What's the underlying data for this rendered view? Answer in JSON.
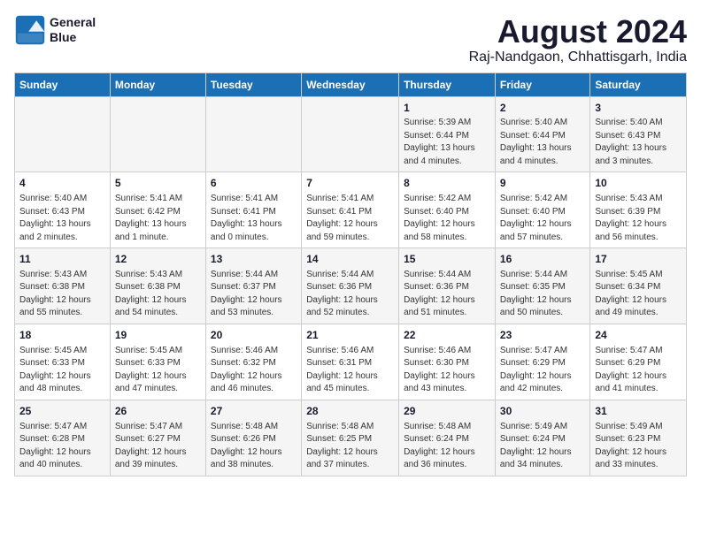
{
  "header": {
    "logo_line1": "General",
    "logo_line2": "Blue",
    "month_year": "August 2024",
    "location": "Raj-Nandgaon, Chhattisgarh, India"
  },
  "weekdays": [
    "Sunday",
    "Monday",
    "Tuesday",
    "Wednesday",
    "Thursday",
    "Friday",
    "Saturday"
  ],
  "weeks": [
    [
      {
        "day": "",
        "info": ""
      },
      {
        "day": "",
        "info": ""
      },
      {
        "day": "",
        "info": ""
      },
      {
        "day": "",
        "info": ""
      },
      {
        "day": "1",
        "info": "Sunrise: 5:39 AM\nSunset: 6:44 PM\nDaylight: 13 hours\nand 4 minutes."
      },
      {
        "day": "2",
        "info": "Sunrise: 5:40 AM\nSunset: 6:44 PM\nDaylight: 13 hours\nand 4 minutes."
      },
      {
        "day": "3",
        "info": "Sunrise: 5:40 AM\nSunset: 6:43 PM\nDaylight: 13 hours\nand 3 minutes."
      }
    ],
    [
      {
        "day": "4",
        "info": "Sunrise: 5:40 AM\nSunset: 6:43 PM\nDaylight: 13 hours\nand 2 minutes."
      },
      {
        "day": "5",
        "info": "Sunrise: 5:41 AM\nSunset: 6:42 PM\nDaylight: 13 hours\nand 1 minute."
      },
      {
        "day": "6",
        "info": "Sunrise: 5:41 AM\nSunset: 6:41 PM\nDaylight: 13 hours\nand 0 minutes."
      },
      {
        "day": "7",
        "info": "Sunrise: 5:41 AM\nSunset: 6:41 PM\nDaylight: 12 hours\nand 59 minutes."
      },
      {
        "day": "8",
        "info": "Sunrise: 5:42 AM\nSunset: 6:40 PM\nDaylight: 12 hours\nand 58 minutes."
      },
      {
        "day": "9",
        "info": "Sunrise: 5:42 AM\nSunset: 6:40 PM\nDaylight: 12 hours\nand 57 minutes."
      },
      {
        "day": "10",
        "info": "Sunrise: 5:43 AM\nSunset: 6:39 PM\nDaylight: 12 hours\nand 56 minutes."
      }
    ],
    [
      {
        "day": "11",
        "info": "Sunrise: 5:43 AM\nSunset: 6:38 PM\nDaylight: 12 hours\nand 55 minutes."
      },
      {
        "day": "12",
        "info": "Sunrise: 5:43 AM\nSunset: 6:38 PM\nDaylight: 12 hours\nand 54 minutes."
      },
      {
        "day": "13",
        "info": "Sunrise: 5:44 AM\nSunset: 6:37 PM\nDaylight: 12 hours\nand 53 minutes."
      },
      {
        "day": "14",
        "info": "Sunrise: 5:44 AM\nSunset: 6:36 PM\nDaylight: 12 hours\nand 52 minutes."
      },
      {
        "day": "15",
        "info": "Sunrise: 5:44 AM\nSunset: 6:36 PM\nDaylight: 12 hours\nand 51 minutes."
      },
      {
        "day": "16",
        "info": "Sunrise: 5:44 AM\nSunset: 6:35 PM\nDaylight: 12 hours\nand 50 minutes."
      },
      {
        "day": "17",
        "info": "Sunrise: 5:45 AM\nSunset: 6:34 PM\nDaylight: 12 hours\nand 49 minutes."
      }
    ],
    [
      {
        "day": "18",
        "info": "Sunrise: 5:45 AM\nSunset: 6:33 PM\nDaylight: 12 hours\nand 48 minutes."
      },
      {
        "day": "19",
        "info": "Sunrise: 5:45 AM\nSunset: 6:33 PM\nDaylight: 12 hours\nand 47 minutes."
      },
      {
        "day": "20",
        "info": "Sunrise: 5:46 AM\nSunset: 6:32 PM\nDaylight: 12 hours\nand 46 minutes."
      },
      {
        "day": "21",
        "info": "Sunrise: 5:46 AM\nSunset: 6:31 PM\nDaylight: 12 hours\nand 45 minutes."
      },
      {
        "day": "22",
        "info": "Sunrise: 5:46 AM\nSunset: 6:30 PM\nDaylight: 12 hours\nand 43 minutes."
      },
      {
        "day": "23",
        "info": "Sunrise: 5:47 AM\nSunset: 6:29 PM\nDaylight: 12 hours\nand 42 minutes."
      },
      {
        "day": "24",
        "info": "Sunrise: 5:47 AM\nSunset: 6:29 PM\nDaylight: 12 hours\nand 41 minutes."
      }
    ],
    [
      {
        "day": "25",
        "info": "Sunrise: 5:47 AM\nSunset: 6:28 PM\nDaylight: 12 hours\nand 40 minutes."
      },
      {
        "day": "26",
        "info": "Sunrise: 5:47 AM\nSunset: 6:27 PM\nDaylight: 12 hours\nand 39 minutes."
      },
      {
        "day": "27",
        "info": "Sunrise: 5:48 AM\nSunset: 6:26 PM\nDaylight: 12 hours\nand 38 minutes."
      },
      {
        "day": "28",
        "info": "Sunrise: 5:48 AM\nSunset: 6:25 PM\nDaylight: 12 hours\nand 37 minutes."
      },
      {
        "day": "29",
        "info": "Sunrise: 5:48 AM\nSunset: 6:24 PM\nDaylight: 12 hours\nand 36 minutes."
      },
      {
        "day": "30",
        "info": "Sunrise: 5:49 AM\nSunset: 6:24 PM\nDaylight: 12 hours\nand 34 minutes."
      },
      {
        "day": "31",
        "info": "Sunrise: 5:49 AM\nSunset: 6:23 PM\nDaylight: 12 hours\nand 33 minutes."
      }
    ]
  ]
}
